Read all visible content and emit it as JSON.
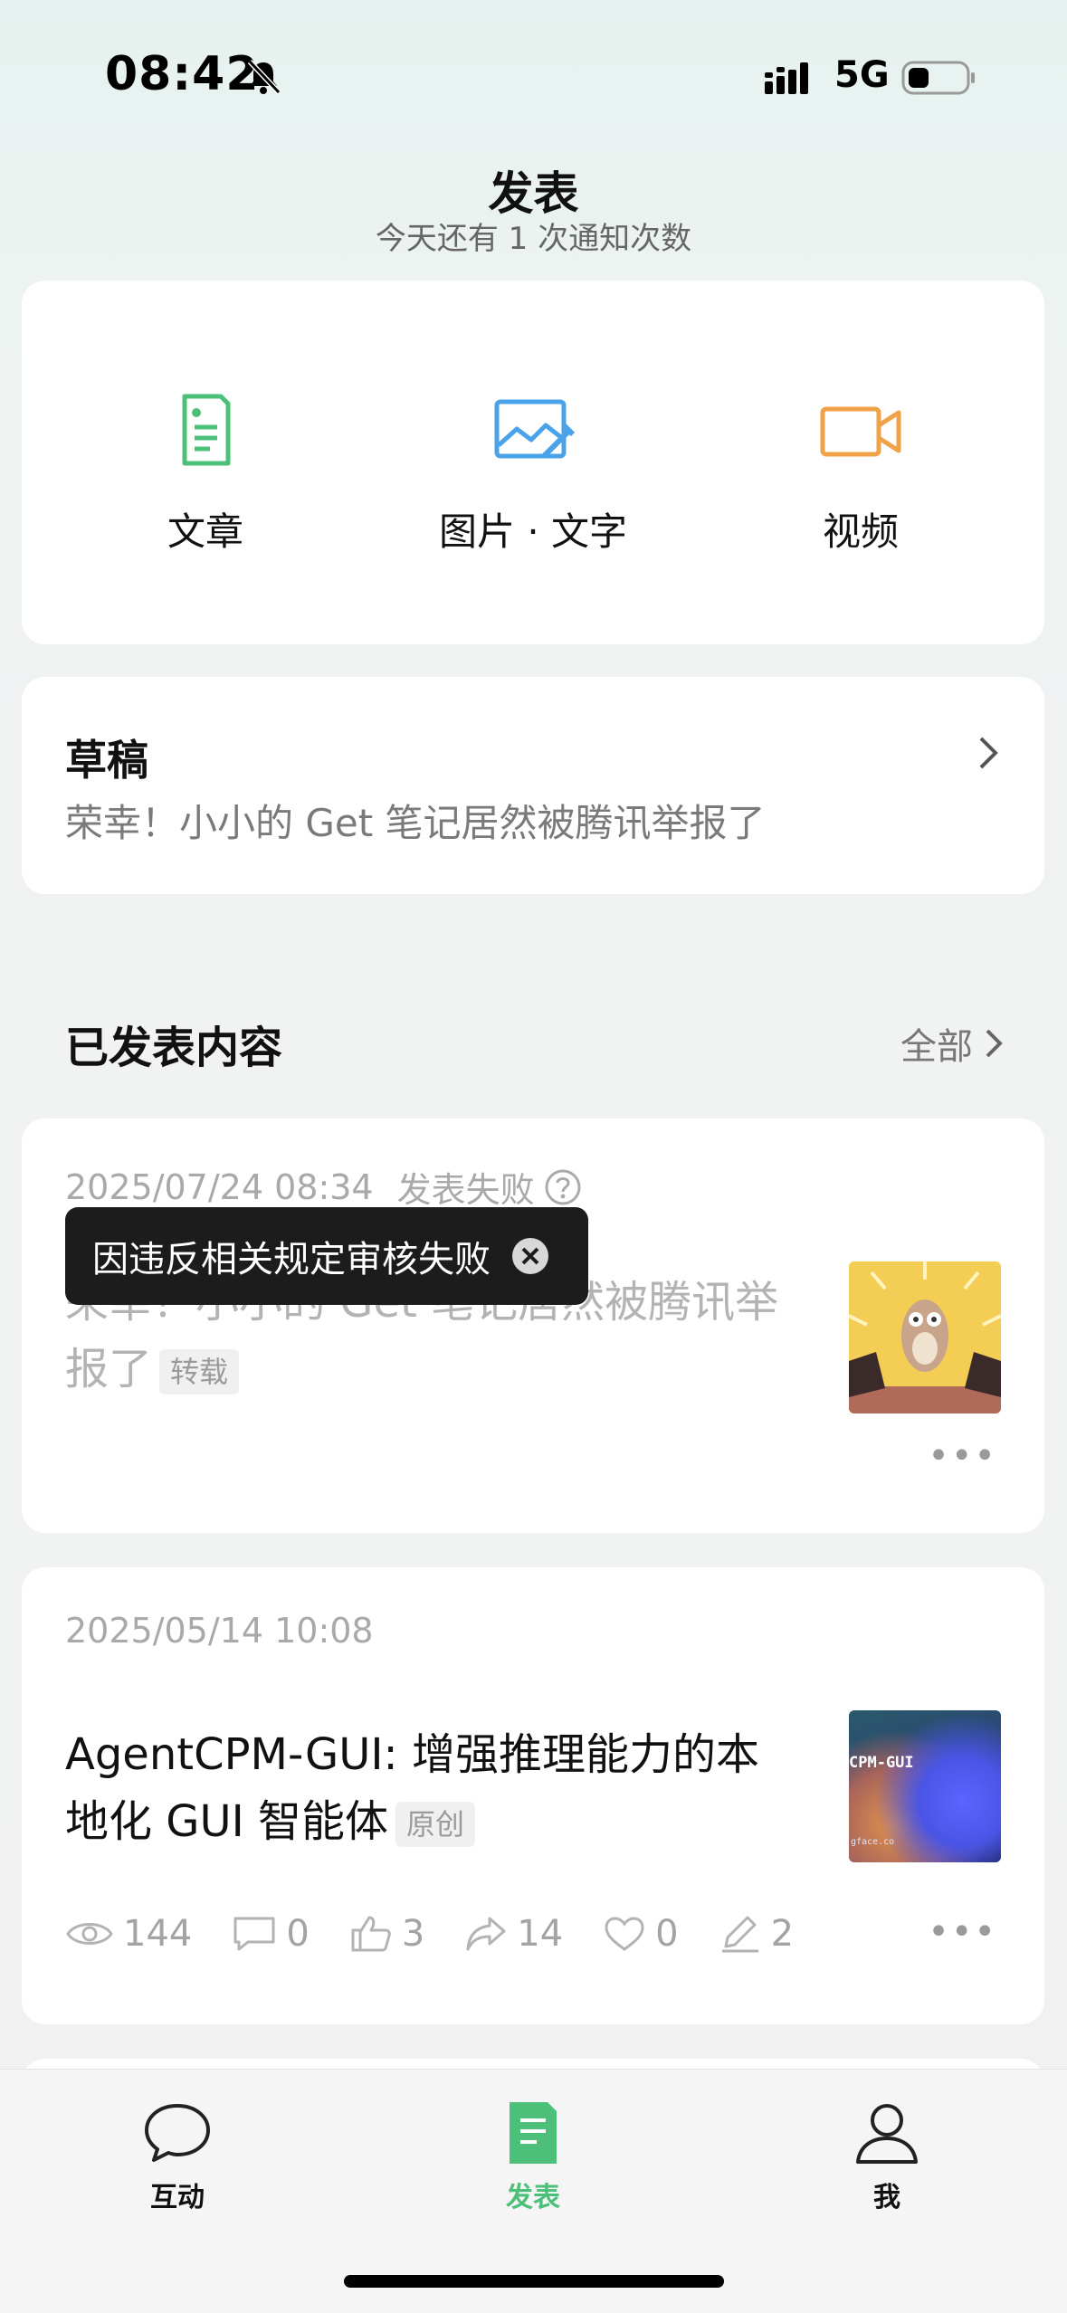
{
  "status_bar": {
    "time": "08:42",
    "network": "5G",
    "icons": [
      "bell-muted-icon",
      "signal-icon",
      "battery-icon"
    ]
  },
  "header": {
    "title": "发表",
    "subtitle": "今天还有 1 次通知次数"
  },
  "publish": {
    "items": [
      {
        "label": "文章",
        "icon": "article-icon",
        "color": "#4cbf78"
      },
      {
        "label": "图片 · 文字",
        "icon": "image-text-icon",
        "color": "#4aa3e8"
      },
      {
        "label": "视频",
        "icon": "video-icon",
        "color": "#f0a248"
      }
    ]
  },
  "draft": {
    "title": "草稿",
    "text": "荣幸！小小的 Get 笔记居然被腾讯举报了"
  },
  "published": {
    "title": "已发表内容",
    "all_label": "全部"
  },
  "posts": [
    {
      "date": "2025/07/24 08:34",
      "status": "发表失败",
      "title_line1": "荣幸！小小的 Get 笔记居然被腾讯举",
      "title_line2": "报了",
      "tag": "转载",
      "toast": "因违反相关规定审核失败"
    },
    {
      "date": "2025/05/14 10:08",
      "title_line1": "AgentCPM-GUI: 增强推理能力的本",
      "title_line2": "地化 GUI 智能体",
      "tag": "原创",
      "thumb_text": "CPM-GUI",
      "thumb_small": "gface.co",
      "stats": {
        "views": "144",
        "comments": "0",
        "likes": "3",
        "shares": "14",
        "favorites": "0",
        "edits": "2"
      }
    }
  ],
  "tabbar": {
    "tabs": [
      {
        "label": "互动",
        "icon": "chat-bubble-icon"
      },
      {
        "label": "发表",
        "icon": "document-icon",
        "active": true
      },
      {
        "label": "我",
        "icon": "person-icon"
      }
    ],
    "active_color": "#4cbf78"
  }
}
